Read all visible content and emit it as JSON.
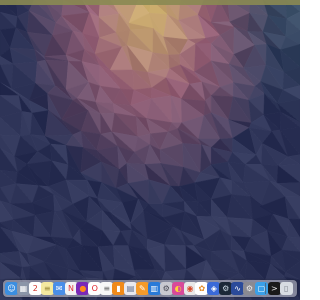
{
  "desktop": {
    "wallpaper": "low-poly gradient: warm yellow top center, pink/mauve middle, dark navy blue edges and bottom"
  },
  "menubar": {
    "color": "#8a8a52"
  },
  "dock": {
    "items": [
      {
        "name": "finder-icon",
        "glyph": "☺",
        "bg": "#3b8ee0",
        "fg": "#ffffff"
      },
      {
        "name": "launchpad-icon",
        "glyph": "▦",
        "bg": "#8b95a8",
        "fg": "#ffffff"
      },
      {
        "name": "calendar-icon",
        "glyph": "2",
        "bg": "#ffffff",
        "fg": "#d0342c"
      },
      {
        "name": "notes-icon",
        "glyph": "≡",
        "bg": "#f4e9a0",
        "fg": "#9a8a3a"
      },
      {
        "name": "mail-icon",
        "glyph": "✉",
        "bg": "#4a8ee8",
        "fg": "#ffffff"
      },
      {
        "name": "news-icon",
        "glyph": "N",
        "bg": "#f3f3f3",
        "fg": "#e2343a"
      },
      {
        "name": "firefox-icon",
        "glyph": "●",
        "bg": "#7a2ab8",
        "fg": "#ff8a1c"
      },
      {
        "name": "opera-icon",
        "glyph": "O",
        "bg": "#ffffff",
        "fg": "#e0202a"
      },
      {
        "name": "document-icon",
        "glyph": "≡",
        "bg": "#f7f7f7",
        "fg": "#6a6a6a"
      },
      {
        "name": "books-icon",
        "glyph": "▮",
        "bg": "#f08a1a",
        "fg": "#ffffff"
      },
      {
        "name": "preview-icon",
        "glyph": "▤",
        "bg": "#e8e8ef",
        "fg": "#5a6a8a"
      },
      {
        "name": "pages-icon",
        "glyph": "✎",
        "bg": "#f59a2a",
        "fg": "#ffffff"
      },
      {
        "name": "keynote-icon",
        "glyph": "▥",
        "bg": "#2a7ad8",
        "fg": "#ffffff"
      },
      {
        "name": "utility-icon",
        "glyph": "⚙",
        "bg": "#c8c8d0",
        "fg": "#4a4a55"
      },
      {
        "name": "colorsync-icon",
        "glyph": "◐",
        "bg": "#d84a9a",
        "fg": "#ffd23a"
      },
      {
        "name": "chrome-icon",
        "glyph": "◉",
        "bg": "#e8e8e8",
        "fg": "#d84a2a"
      },
      {
        "name": "photos-icon",
        "glyph": "✿",
        "bg": "#ffffff",
        "fg": "#e08a2a"
      },
      {
        "name": "blue-app-icon",
        "glyph": "◈",
        "bg": "#3a6ad8",
        "fg": "#ffffff"
      },
      {
        "name": "steam-icon",
        "glyph": "⚙",
        "bg": "#1b2838",
        "fg": "#c7d5e0"
      },
      {
        "name": "wave-app-icon",
        "glyph": "∿",
        "bg": "#2a4a9a",
        "fg": "#ffffff"
      },
      {
        "name": "settings-icon",
        "glyph": "⚙",
        "bg": "#8a8a92",
        "fg": "#e8e8e8"
      },
      {
        "name": "screenshot-icon",
        "glyph": "▢",
        "bg": "#3aa0e8",
        "fg": "#ffffff"
      },
      {
        "name": "terminal-icon",
        "glyph": ">",
        "bg": "#1a1a1a",
        "fg": "#e8e8e8"
      },
      {
        "name": "trash-icon",
        "glyph": "▯",
        "bg": "#d8dce2",
        "fg": "#7a808a"
      }
    ]
  }
}
